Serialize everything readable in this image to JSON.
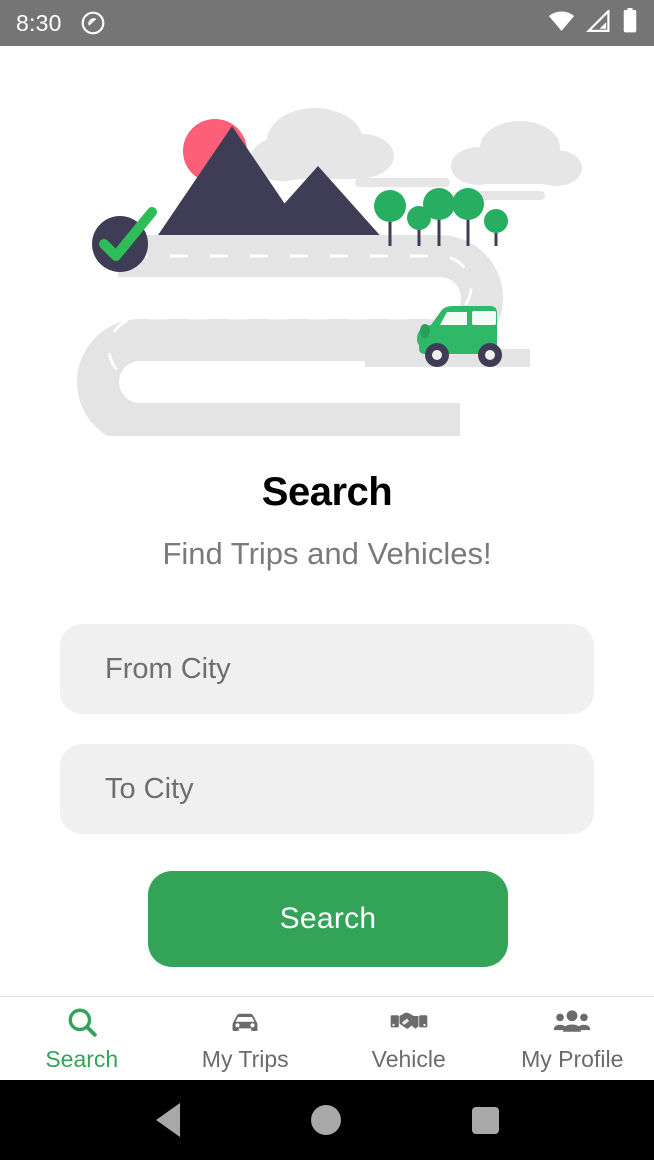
{
  "status_bar": {
    "time": "8:30",
    "icons": [
      "dnd-icon",
      "wifi-icon",
      "cellular-signal-icon",
      "battery-icon"
    ],
    "background": "#757575"
  },
  "illustration": {
    "name": "road-trip-illustration",
    "elements": [
      "check-circle",
      "mountains",
      "sun",
      "clouds",
      "trees",
      "winding-road",
      "green-car"
    ],
    "colors": {
      "mountain": "#3f3d56",
      "sun": "#fd5f78",
      "cloud": "#e6e6e6",
      "road": "#e4e4e4",
      "tree": "#27ae60",
      "car": "#2eb867",
      "check": "#2ebd59"
    }
  },
  "main": {
    "title": "Search",
    "subtitle": "Find Trips and Vehicles!",
    "from_field": {
      "value": "",
      "placeholder": "From City"
    },
    "to_field": {
      "value": "",
      "placeholder": "To City"
    },
    "search_button": "Search"
  },
  "tab_bar": {
    "active_index": 0,
    "accent_color": "#33a358",
    "inactive_color": "#6b6b6b",
    "tabs": [
      {
        "label": "Search",
        "icon": "magnifier-icon"
      },
      {
        "label": "My Trips",
        "icon": "car-icon"
      },
      {
        "label": "Vehicle",
        "icon": "handshake-icon"
      },
      {
        "label": "My Profile",
        "icon": "people-group-icon"
      }
    ]
  },
  "nav_bar": {
    "buttons": [
      {
        "name": "back-button",
        "icon": "triangle-left-icon"
      },
      {
        "name": "home-button",
        "icon": "circle-icon"
      },
      {
        "name": "recents-button",
        "icon": "square-icon"
      }
    ]
  }
}
